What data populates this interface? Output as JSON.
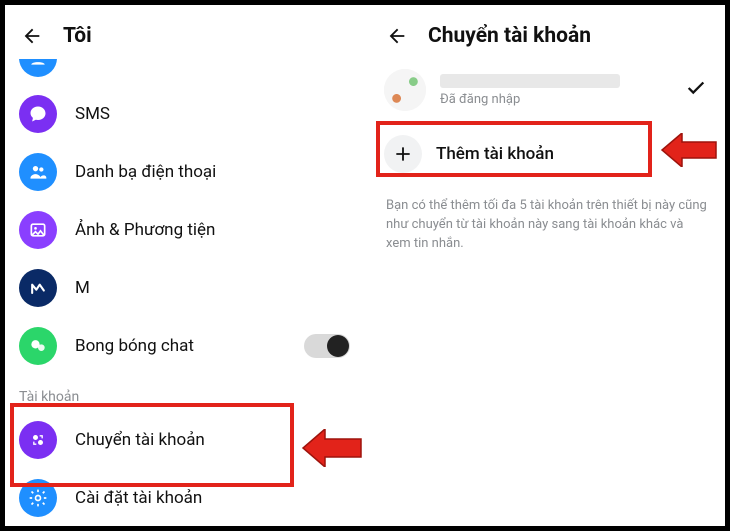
{
  "left": {
    "title": "Tôi",
    "items": [
      {
        "label": "SMS",
        "color": "#7b2ff2",
        "icon": "chat"
      },
      {
        "label": "Danh bạ điện thoại",
        "color": "#1f8fff",
        "icon": "people"
      },
      {
        "label": "Ảnh & Phương tiện",
        "color": "#8a3fff",
        "icon": "photo"
      },
      {
        "label": "M",
        "color": "#0a2a66",
        "icon": "m"
      },
      {
        "label": "Bong bóng chat",
        "color": "#2bd66a",
        "icon": "bubbles",
        "toggle": true
      }
    ],
    "section": "Tài khoản",
    "account_items": [
      {
        "label": "Chuyển tài khoản",
        "color": "#7b2ff2",
        "icon": "switch"
      },
      {
        "label": "Cài đặt tài khoản",
        "color": "#1f8fff",
        "icon": "gear"
      }
    ]
  },
  "right": {
    "title": "Chuyển tài khoản",
    "logged_in": "Đã đăng nhập",
    "add_label": "Thêm tài khoản",
    "helper": "Bạn có thể thêm tối đa 5 tài khoản trên thiết bị này cũng như chuyển từ tài khoản này sang tài khoản khác và xem tin nhắn."
  }
}
